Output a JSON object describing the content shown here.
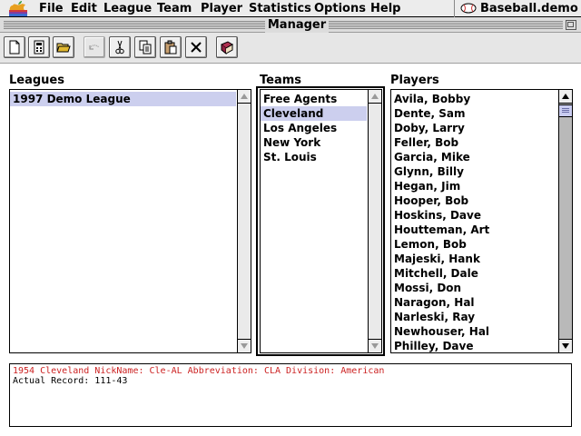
{
  "menubar": {
    "items": [
      "File",
      "Edit",
      "League",
      "Team",
      "Player",
      "Statistics",
      "Options",
      "Help"
    ],
    "app_switch": "Baseball.demo"
  },
  "window": {
    "title": "Manager"
  },
  "toolbar": {
    "buttons": [
      {
        "icon": "new-document-icon",
        "enabled": true
      },
      {
        "icon": "calculator-icon",
        "enabled": true
      },
      {
        "icon": "open-folder-icon",
        "enabled": true
      },
      {
        "icon": "undo-icon",
        "enabled": false
      },
      {
        "icon": "scissors-icon",
        "enabled": true
      },
      {
        "icon": "copy-icon",
        "enabled": true
      },
      {
        "icon": "paste-icon",
        "enabled": true
      },
      {
        "icon": "delete-x-icon",
        "enabled": true
      },
      {
        "icon": "book-icon",
        "enabled": true
      }
    ]
  },
  "leagues": {
    "label": "Leagues",
    "items": [
      "1997 Demo League"
    ],
    "selected": "1997 Demo League"
  },
  "teams": {
    "label": "Teams",
    "items": [
      "Free Agents",
      "Cleveland",
      "Los Angeles",
      "New York",
      "St. Louis"
    ],
    "selected": "Cleveland"
  },
  "players": {
    "label": "Players",
    "items": [
      "Avila, Bobby",
      "Dente, Sam",
      "Doby, Larry",
      "Feller, Bob",
      "Garcia, Mike",
      "Glynn, Billy",
      "Hegan, Jim",
      "Hooper, Bob",
      "Hoskins, Dave",
      "Houtteman, Art",
      "Lemon, Bob",
      "Majeski, Hank",
      "Mitchell, Dale",
      "Mossi, Don",
      "Naragon, Hal",
      "Narleski, Ray",
      "Newhouser, Hal",
      "Philley, Dave"
    ]
  },
  "info": {
    "line1": "1954 Cleveland  NickName: Cle-AL  Abbreviation: CLA  Division: American",
    "line2": "Actual Record: 111-43"
  },
  "colors": {
    "selection": "#cccfee",
    "info_highlight": "#cc2222"
  }
}
